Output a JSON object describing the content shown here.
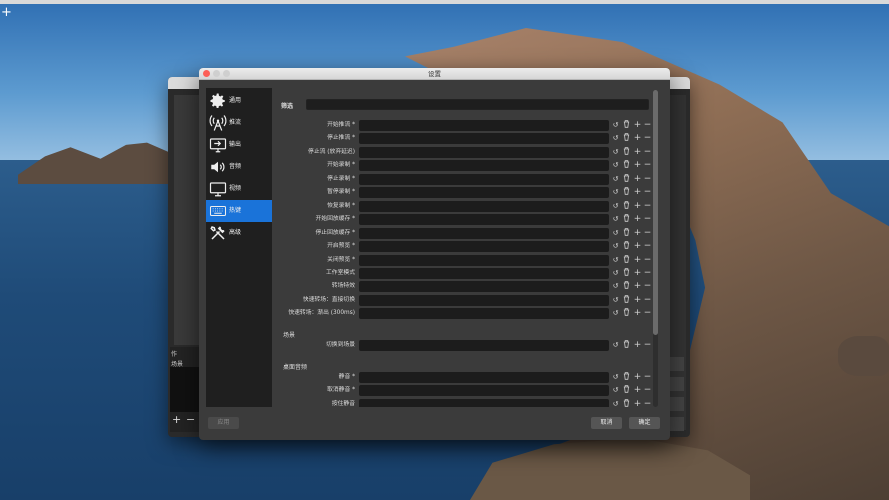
{
  "window": {
    "title": "设置",
    "icon_names": {
      "close": "close-traffic-light",
      "minimize": "minimize-traffic-light",
      "maximize": "maximize-traffic-light"
    }
  },
  "colors": {
    "accent": "#1a73d9",
    "dialog_bg": "#3b3b3b",
    "sidebar_bg": "#1f1f1f",
    "field_bg": "#1c1c1c"
  },
  "sidebar": {
    "items": [
      {
        "label": "通用",
        "icon": "gear-icon",
        "active": false
      },
      {
        "label": "推流",
        "icon": "broadcast-icon",
        "active": false
      },
      {
        "label": "输出",
        "icon": "output-icon",
        "active": false
      },
      {
        "label": "音频",
        "icon": "speaker-icon",
        "active": false
      },
      {
        "label": "视频",
        "icon": "monitor-icon",
        "active": false
      },
      {
        "label": "热键",
        "icon": "keyboard-icon",
        "active": true
      },
      {
        "label": "高级",
        "icon": "tools-icon",
        "active": false
      }
    ]
  },
  "filter": {
    "label": "筛选",
    "value": ""
  },
  "hotkeys": {
    "general": [
      "开始推流 *",
      "停止推流 *",
      "停止流 (放弃延迟)",
      "开始录制 *",
      "停止录制 *",
      "暂停录制 *",
      "恢复录制 *",
      "开始回放缓存 *",
      "停止回放缓存 *",
      "开启预览 *",
      "关闭预览 *",
      "工作室模式",
      "转场特效",
      "快速转场：直接切换",
      "快速转场：渐出 (300ms)"
    ],
    "scenes_section": "场景",
    "scenes": [
      "切换到场景"
    ],
    "desktop_audio_section": "桌面音频",
    "desktop_audio": [
      "静音 *",
      "取消静音 *",
      "按住静音"
    ]
  },
  "row_controls": {
    "reset": "↺",
    "trash": "🗑",
    "add": "+",
    "remove": "−"
  },
  "buttons": {
    "apply": "应用",
    "cancel": "取消",
    "ok": "确定"
  },
  "background_window": {
    "dock_header": "作",
    "scene_header": "场景",
    "add": "+",
    "remove": "−"
  }
}
